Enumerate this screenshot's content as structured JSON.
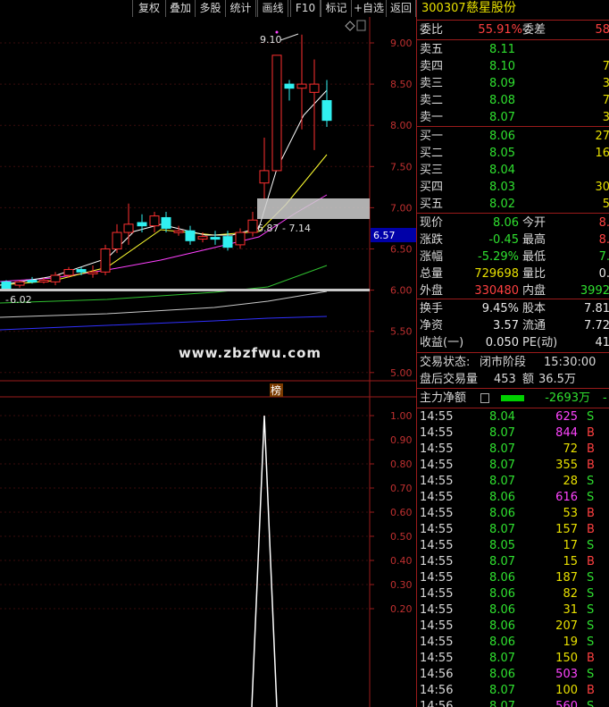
{
  "toolbar": {
    "buttons": [
      "复权",
      "叠加",
      "多股",
      "统计",
      "画线",
      "F10",
      "标记",
      "+自选",
      "返回"
    ]
  },
  "chart": {
    "price_ticks": [
      "9.00",
      "8.50",
      "8.00",
      "7.50",
      "7.00",
      "6.50",
      "6.00",
      "5.50",
      "5.00"
    ],
    "current_price_tag": "6.57",
    "high_label": "9.10",
    "low_label": "6.02",
    "box_label": "6.87 - 7.14",
    "watermark": "www.zbzfwu.com",
    "indicator_tag": "榜",
    "indicator_ticks": [
      "1.00",
      "0.90",
      "0.80",
      "0.70",
      "0.60",
      "0.50",
      "0.40",
      "0.30",
      "0.20"
    ],
    "colors": {
      "up": "#ff3030",
      "down": "#30f0f0",
      "ma5": "#ffffff",
      "ma10": "#ffff30",
      "ma20": "#ff40ff",
      "ma60": "#30c030",
      "ma120": "#c8c8c8",
      "ma250": "#3030ff"
    }
  },
  "quote": {
    "code": "300307",
    "name": "慈星股份",
    "weibi_label": "委比",
    "weibi_value": "55.91%",
    "weicha_label": "委差",
    "weicha_value": "58",
    "asks": [
      {
        "label": "卖五",
        "price": "8.11",
        "vol": ""
      },
      {
        "label": "卖四",
        "price": "8.10",
        "vol": "7"
      },
      {
        "label": "卖三",
        "price": "8.09",
        "vol": "3"
      },
      {
        "label": "卖二",
        "price": "8.08",
        "vol": "7"
      },
      {
        "label": "卖一",
        "price": "8.07",
        "vol": "3"
      }
    ],
    "bids": [
      {
        "label": "买一",
        "price": "8.06",
        "vol": "27"
      },
      {
        "label": "买二",
        "price": "8.05",
        "vol": "16"
      },
      {
        "label": "买三",
        "price": "8.04",
        "vol": ""
      },
      {
        "label": "买四",
        "price": "8.03",
        "vol": "30"
      },
      {
        "label": "买五",
        "price": "8.02",
        "vol": "5"
      }
    ],
    "stats": [
      {
        "l1": "现价",
        "v1": "8.06",
        "c1": "grn",
        "l2": "今开",
        "v2": "8.",
        "c2": "red"
      },
      {
        "l1": "涨跌",
        "v1": "-0.45",
        "c1": "grn",
        "l2": "最高",
        "v2": "8.",
        "c2": "red"
      },
      {
        "l1": "涨幅",
        "v1": "-5.29%",
        "c1": "grn",
        "l2": "最低",
        "v2": "7.",
        "c2": "grn"
      },
      {
        "l1": "总量",
        "v1": "729698",
        "c1": "yel",
        "l2": "量比",
        "v2": "0.",
        "c2": "wht"
      },
      {
        "l1": "外盘",
        "v1": "330480",
        "c1": "red",
        "l2": "内盘",
        "v2": "3992",
        "c2": "grn"
      }
    ],
    "fund": [
      {
        "l1": "换手",
        "v1": "9.45%",
        "l2": "股本",
        "v2": "7.81"
      },
      {
        "l1": "净资",
        "v1": "3.57",
        "l2": "流通",
        "v2": "7.72"
      },
      {
        "l1": "收益(一)",
        "v1": "0.050",
        "l2": "PE(动)",
        "v2": "41"
      }
    ],
    "trade_status_label": "交易状态:",
    "trade_status": "闭市阶段",
    "trade_time": "15:30:00",
    "after_hours_label": "盘后交易量",
    "after_hours_vol": "453",
    "after_hours_amt_label": "额",
    "after_hours_amt": "36.5万",
    "main_net_label": "主力净额",
    "main_net_value": "-2693万",
    "main_net_extra": "-"
  },
  "ticks": [
    {
      "time": "14:55",
      "price": "8.04",
      "vol": "625",
      "vc": "mag",
      "side": "S"
    },
    {
      "time": "14:55",
      "price": "8.07",
      "vol": "844",
      "vc": "mag",
      "side": "B"
    },
    {
      "time": "14:55",
      "price": "8.07",
      "vol": "72",
      "vc": "yel",
      "side": "B"
    },
    {
      "time": "14:55",
      "price": "8.07",
      "vol": "355",
      "vc": "yel",
      "side": "B"
    },
    {
      "time": "14:55",
      "price": "8.07",
      "vol": "28",
      "vc": "yel",
      "side": "S"
    },
    {
      "time": "14:55",
      "price": "8.06",
      "vol": "616",
      "vc": "mag",
      "side": "S"
    },
    {
      "time": "14:55",
      "price": "8.06",
      "vol": "53",
      "vc": "yel",
      "side": "B"
    },
    {
      "time": "14:55",
      "price": "8.07",
      "vol": "157",
      "vc": "yel",
      "side": "B"
    },
    {
      "time": "14:55",
      "price": "8.05",
      "vol": "17",
      "vc": "yel",
      "side": "S"
    },
    {
      "time": "14:55",
      "price": "8.07",
      "vol": "15",
      "vc": "yel",
      "side": "B"
    },
    {
      "time": "14:55",
      "price": "8.06",
      "vol": "187",
      "vc": "yel",
      "side": "S"
    },
    {
      "time": "14:55",
      "price": "8.06",
      "vol": "82",
      "vc": "yel",
      "side": "S"
    },
    {
      "time": "14:55",
      "price": "8.06",
      "vol": "31",
      "vc": "yel",
      "side": "S"
    },
    {
      "time": "14:55",
      "price": "8.06",
      "vol": "207",
      "vc": "yel",
      "side": "S"
    },
    {
      "time": "14:55",
      "price": "8.06",
      "vol": "19",
      "vc": "yel",
      "side": "S"
    },
    {
      "time": "14:55",
      "price": "8.07",
      "vol": "150",
      "vc": "yel",
      "side": "B"
    },
    {
      "time": "14:56",
      "price": "8.06",
      "vol": "503",
      "vc": "mag",
      "side": "S"
    },
    {
      "time": "14:56",
      "price": "8.07",
      "vol": "100",
      "vc": "yel",
      "side": "B"
    },
    {
      "time": "14:56",
      "price": "8.07",
      "vol": "560",
      "vc": "mag",
      "side": "S"
    }
  ]
}
